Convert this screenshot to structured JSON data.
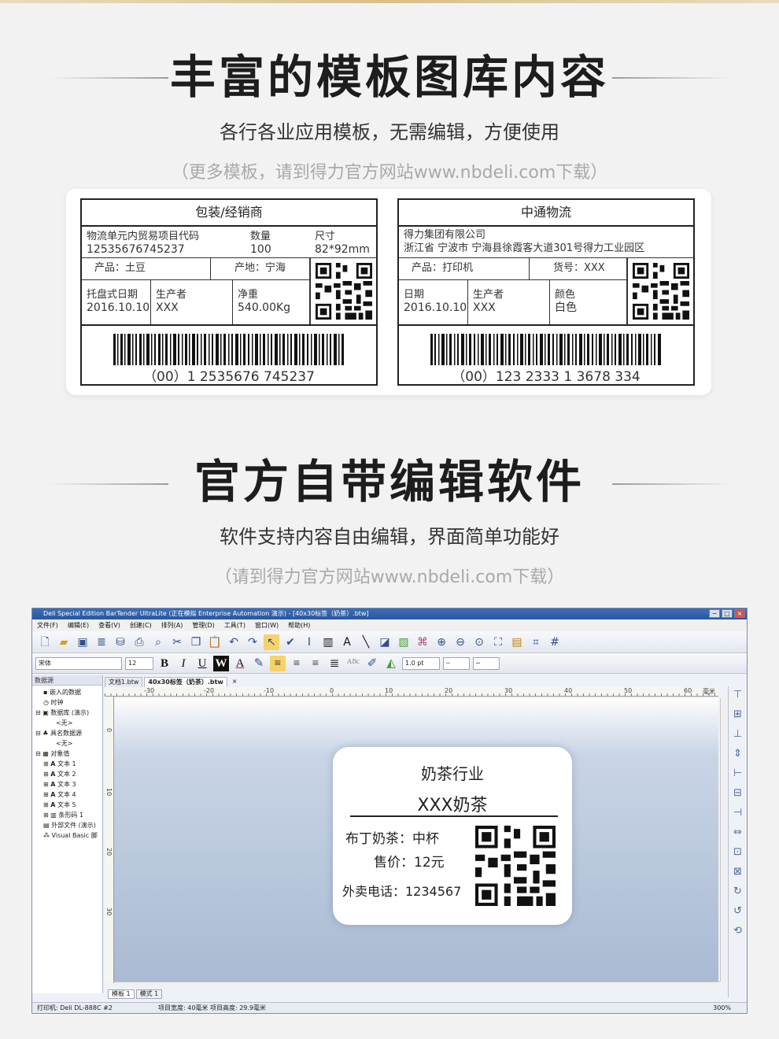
{
  "section1": {
    "title": "丰富的模板图库内容",
    "subtitle": "各行各业应用模板，无需编辑，方便使用",
    "note": "（更多模板，请到得力官方网站www.nbdeli.com下载）"
  },
  "label1": {
    "title": "包装/经销商",
    "code_label": "物流单元内贸易项目代码",
    "code_value": "12535676745237",
    "qty_label": "数量",
    "qty_value": "100",
    "size_label": "尺寸",
    "size_value": "82*92mm",
    "product": "产品：土豆",
    "origin": "产地：宁海",
    "date_label": "托盘式日期",
    "date_value": "2016.10.10",
    "maker_label": "生产者",
    "maker_value": "XXX",
    "weight_label": "净重",
    "weight_value": "540.00Kg",
    "barcode_text": "（00）1 2535676 745237"
  },
  "label2": {
    "title": "中通物流",
    "company": "得力集团有限公司",
    "address": "浙江省 宁波市 宁海县徐霞客大道301号得力工业园区",
    "product": "产品：打印机",
    "item_no": "货号：XXX",
    "date_label": "日期",
    "date_value": "2016.10.10",
    "maker_label": "生产者",
    "maker_value": "XXX",
    "color_label": "颜色",
    "color_value": "白色",
    "barcode_text": "（00）123 2333 1 3678 334"
  },
  "section2": {
    "title": "官方自带编辑软件",
    "subtitle": "软件支持内容自由编辑，界面简单功能好",
    "note": "（请到得力官方网站www.nbdeli.com下载）"
  },
  "app": {
    "window_title": "Deli Special Edition BarTender UltraLite (正在模拟 Enterprise Automation 演示) - [40x30标签（奶茶）.btw]",
    "menu": [
      "文件(F)",
      "编辑(E)",
      "查看(V)",
      "创建(C)",
      "排列(A)",
      "管理(D)",
      "工具(T)",
      "窗口(W)",
      "帮助(H)"
    ],
    "font_name": "宋体",
    "font_size": "12",
    "line_width": "1.0 pt",
    "panel_title": "数据源",
    "tree": [
      "嵌入的数据",
      "时钟",
      "数据库 (演示)",
      "<无>",
      "具名数据源",
      "<无>",
      "对象值",
      "文本 1",
      "文本 2",
      "文本 3",
      "文本 4",
      "文本 5",
      "条形码 1",
      "外部文件 (演示)",
      "Visual Basic 脚"
    ],
    "doc_tabs": [
      "文档1.btw",
      "40x30标签（奶茶）.btw"
    ],
    "ruler_marks": [
      "-30",
      "-20",
      "-10",
      "0",
      "10",
      "20",
      "30",
      "40",
      "50",
      "60",
      "毫米"
    ],
    "vruler_marks": [
      "0",
      "10",
      "20",
      "30"
    ],
    "bottom_tabs": [
      "模板 1",
      "模式 1"
    ],
    "status_printer": "打印机: Deli DL-888C #2",
    "status_size": "项目宽度: 40毫米  项目高度: 29.9毫米",
    "status_zoom": "300%"
  },
  "milktea": {
    "line1": "奶茶行业",
    "line2": "XXX奶茶",
    "line3": "布丁奶茶：中杯",
    "line4": "售价：12元",
    "line5": "外卖电话：1234567"
  }
}
